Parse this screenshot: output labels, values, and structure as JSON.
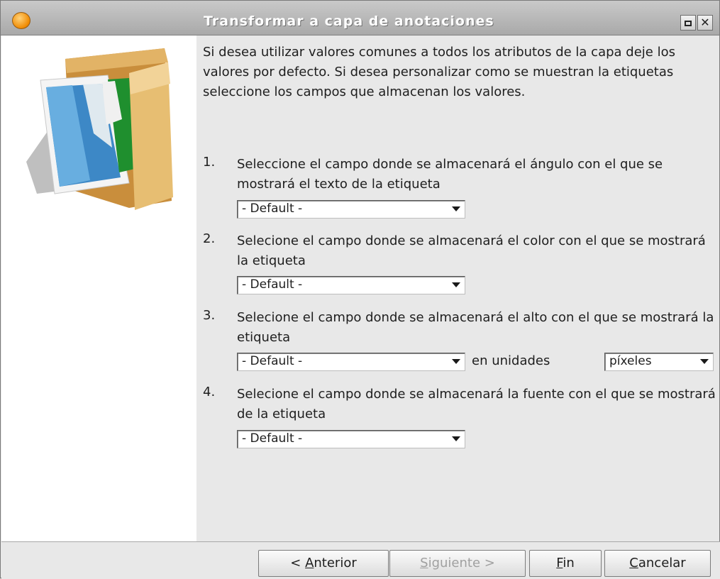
{
  "window": {
    "title": "Transformar a capa de anotaciones"
  },
  "icons": {
    "app": "app-logo-icon",
    "maximize": "maximize-icon",
    "close": "close-icon",
    "illustration": "folder-with-images-illustration"
  },
  "intro_text": "Si desea utilizar valores comunes a todos los atributos de la capa deje los valores por defecto. Si desea personalizar como se muestran la etiquetas seleccione los campos que almacenan los valores.",
  "steps": [
    {
      "number": "1.",
      "text": "Seleccione el campo donde se almacenará el ángulo con el que se mostrará el texto de la etiqueta",
      "select_value": "- Default -"
    },
    {
      "number": "2.",
      "text": "Selecione el campo donde se almacenará el color con el que se mostrará la etiqueta",
      "select_value": "- Default -"
    },
    {
      "number": "3.",
      "text": "Selecione el campo donde se almacenará el alto con el que se mostrará la etiqueta",
      "select_value": "- Default -",
      "units_label": "en unidades",
      "units_value": "píxeles"
    },
    {
      "number": "4.",
      "text": "Selecione el campo donde se almacenará la fuente con el que se mostrará de la etiqueta",
      "select_value": "- Default -"
    }
  ],
  "buttons": {
    "back": {
      "mnemonic": "A",
      "pre": "< ",
      "rest": "nterior"
    },
    "next": {
      "mnemonic": "S",
      "rest": "iguiente >",
      "enabled": false
    },
    "finish": {
      "mnemonic": "F",
      "rest": "in"
    },
    "cancel": {
      "mnemonic": "C",
      "rest": "ancelar"
    }
  }
}
